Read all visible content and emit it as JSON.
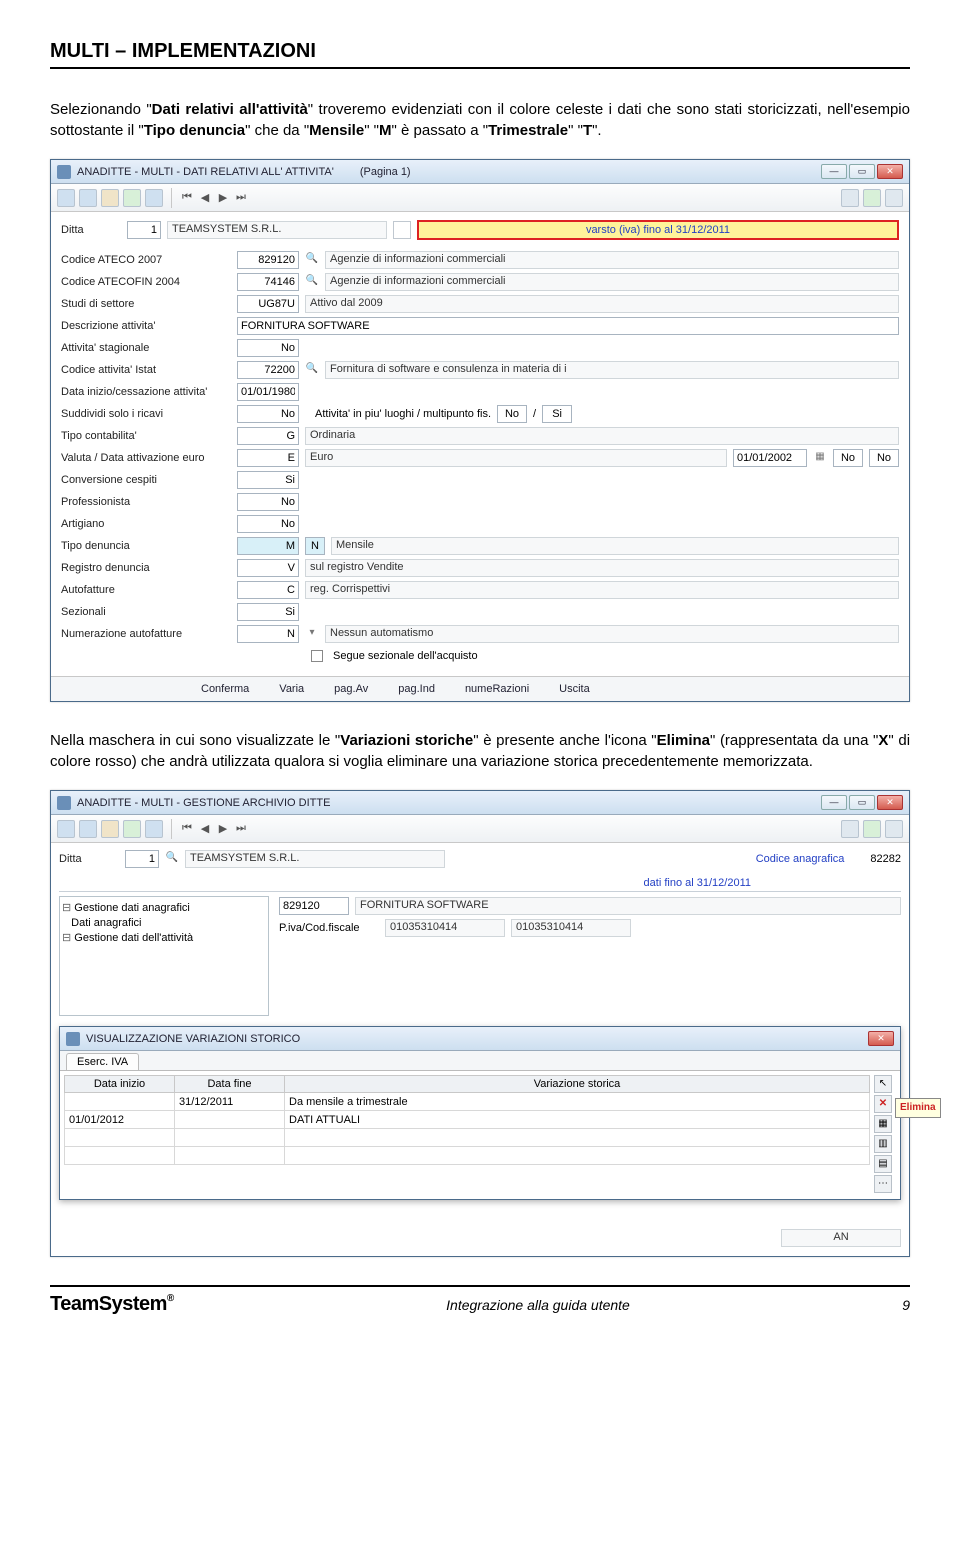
{
  "doc": {
    "header": "MULTI – IMPLEMENTAZIONI",
    "para1_pre": "Selezionando \"",
    "para1_b1": "Dati relativi all'attività",
    "para1_mid1": "\" troveremo evidenziati con il colore celeste i dati che sono stati storicizzati, nell'esempio sottostante il \"",
    "para1_b2": "Tipo denuncia",
    "para1_mid2": "\" che da \"",
    "para1_b3": "Mensile",
    "para1_mid3": "\" \"",
    "para1_b4": "M",
    "para1_mid4": "\" è passato a \"",
    "para1_b5": "Trimestrale",
    "para1_mid5": "\" \"",
    "para1_b6": "T",
    "para1_end": "\".",
    "para2_pre": "Nella maschera in cui sono visualizzate le \"",
    "para2_b1": "Variazioni storiche",
    "para2_mid1": "\" è presente anche l'icona \"",
    "para2_b2": "Elimina",
    "para2_mid2": "\" (rappresentata da una \"",
    "para2_b3": "X",
    "para2_mid3": "\" di colore rosso) che andrà utilizzata qualora si voglia eliminare una variazione storica precedentemente memorizzata.",
    "footer_center": "Integrazione alla guida utente",
    "footer_page": "9",
    "logo": "TeamSystem"
  },
  "win1": {
    "title": "ANADITTE  -  MULTI  -  DATI RELATIVI ALL' ATTIVITA'",
    "page": "(Pagina 1)",
    "ditta_lbl": "Ditta",
    "ditta_val": "1",
    "ditta_name": "TEAMSYSTEM S.R.L.",
    "banner": "varsto (iva) fino al 31/12/2011",
    "rows": [
      {
        "lbl": "Codice ATECO 2007",
        "val": "829120",
        "desc": "Agenzie di informazioni commerciali",
        "lookup": true
      },
      {
        "lbl": "Codice ATECOFIN 2004",
        "val": "74146",
        "desc": "Agenzie di informazioni commerciali",
        "lookup": true
      },
      {
        "lbl": "Studi di settore",
        "val": "UG87U",
        "desc": "Attivo dal 2009"
      },
      {
        "lbl": "Descrizione attivita'",
        "wide": "FORNITURA SOFTWARE"
      },
      {
        "lbl": "Attivita' stagionale",
        "val": "No"
      },
      {
        "lbl": "Codice attivita' Istat",
        "val": "72200",
        "desc": "Fornitura di software e consulenza in materia di i",
        "lookup": true
      },
      {
        "lbl": "Data inizio/cessazione attivita'",
        "val": "01/01/1980"
      },
      {
        "lbl": "Suddividi solo i ricavi",
        "val": "No",
        "extra_lbl": "Attivita' in piu' luoghi / multipunto fis.",
        "extra_v1": "No",
        "extra_sep": "/",
        "extra_v2": "Si"
      },
      {
        "lbl": "Tipo contabilita'",
        "val": "G",
        "desc": "Ordinaria"
      },
      {
        "lbl": "Valuta / Data attivazione euro",
        "val": "E",
        "desc": "Euro",
        "date": "01/01/2002",
        "v3": "No",
        "v4": "No"
      },
      {
        "lbl": "Conversione cespiti",
        "val": "Si"
      },
      {
        "lbl": "Professionista",
        "val": "No"
      },
      {
        "lbl": "Artigiano",
        "val": "No"
      },
      {
        "lbl": "Tipo denuncia",
        "val": "M",
        "val2": "N",
        "desc": "Mensile",
        "hl": true
      },
      {
        "lbl": "Registro denuncia",
        "val": "V",
        "desc": "sul registro Vendite"
      },
      {
        "lbl": "Autofatture",
        "val": "C",
        "desc": "reg. Corrispettivi"
      },
      {
        "lbl": "Sezionali",
        "val": "Si"
      },
      {
        "lbl": "Numerazione autofatture",
        "val": "N",
        "desc": "Nessun automatismo",
        "dd": true
      },
      {
        "chk_lbl": "Segue sezionale dell'acquisto"
      }
    ],
    "footer": [
      "Conferma",
      "Varia",
      "pag.Av",
      "pag.Ind",
      "numeRazioni",
      "Uscita"
    ]
  },
  "win2": {
    "title": "ANADITTE  -  MULTI  -  GESTIONE ARCHIVIO DITTE",
    "ditta_lbl": "Ditta",
    "ditta_val": "1",
    "ditta_name": "TEAMSYSTEM S.R.L.",
    "cod_anag_lbl": "Codice anagrafica",
    "cod_anag_val": "82282",
    "blue_strip": "dati fino al 31/12/2011",
    "tree": [
      {
        "t": "node",
        "lbl": "Gestione dati anagrafici"
      },
      {
        "t": "leaf",
        "lbl": "Dati anagrafici"
      },
      {
        "t": "node",
        "lbl": "Gestione dati dell'attività"
      }
    ],
    "right_row1_val": "829120",
    "right_row1_desc": "FORNITURA SOFTWARE",
    "right_row2_lbl": "P.iva/Cod.fiscale",
    "right_row2_v1": "01035310414",
    "right_row2_v2": "01035310414",
    "right_an": "AN"
  },
  "overlay": {
    "title": "VISUALIZZAZIONE VARIAZIONI STORICO",
    "tab": "Eserc. IVA",
    "headers": [
      "Data inizio",
      "Data fine",
      "Variazione storica"
    ],
    "rows": [
      {
        "di": "",
        "df": "31/12/2011",
        "vs": "Da mensile a trimestrale"
      },
      {
        "di": "01/01/2012",
        "df": "",
        "vs": "DATI ATTUALI"
      },
      {
        "di": "",
        "df": "",
        "vs": ""
      },
      {
        "di": "",
        "df": "",
        "vs": ""
      }
    ],
    "tooltip": "Elimina"
  }
}
